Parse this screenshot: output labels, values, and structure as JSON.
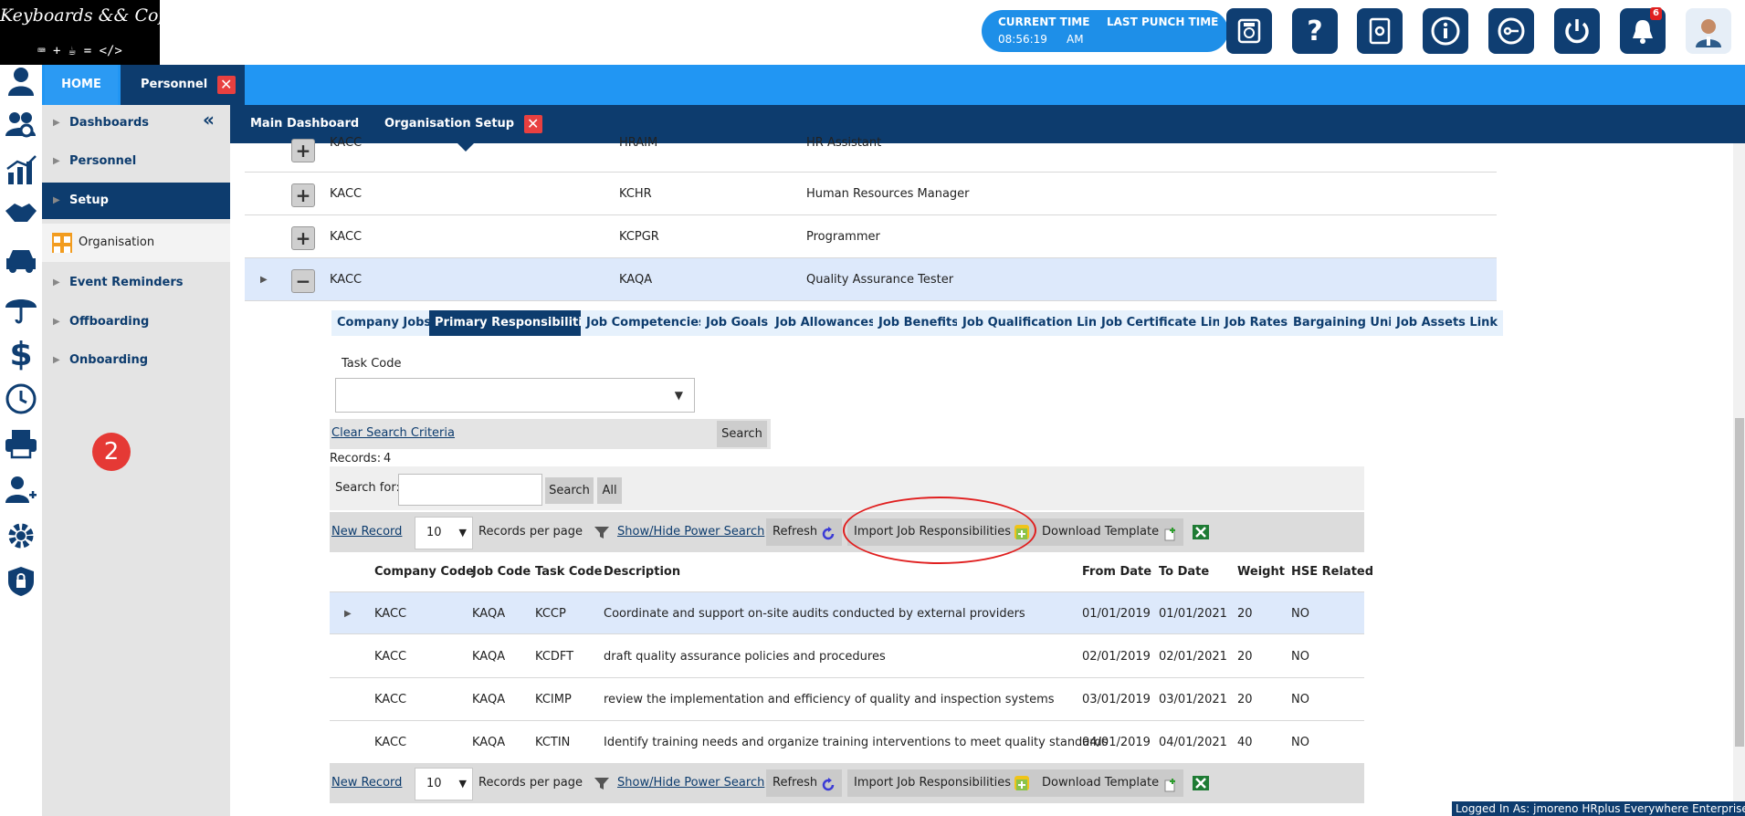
{
  "logo": {
    "title": "Keyboards && Coffee",
    "subtitle": "⌨ + ☕ = </>"
  },
  "topbar": {
    "current_time_label": "CURRENT TIME",
    "last_punch_label": "LAST PUNCH TIME",
    "current_time_value": "08:56:19",
    "am": "AM",
    "notification_count": "6",
    "help_glyph": "?",
    "info_glyph": "i"
  },
  "tabs": {
    "home": "HOME",
    "personnel": "Personnel"
  },
  "subnav": {
    "main_dashboard": "Main Dashboard",
    "organisation_setup": "Organisation Setup"
  },
  "sidebar": {
    "items": [
      {
        "label": "Dashboards"
      },
      {
        "label": "Personnel"
      },
      {
        "label": "Setup"
      },
      {
        "label": "Organisation"
      },
      {
        "label": "Event Reminders"
      },
      {
        "label": "Offboarding"
      },
      {
        "label": "Onboarding"
      }
    ],
    "step_number": "2"
  },
  "jobs": [
    {
      "company": "KACC",
      "code": "HRAIM",
      "title": "HR Assistant"
    },
    {
      "company": "KACC",
      "code": "KCHR",
      "title": "Human Resources Manager"
    },
    {
      "company": "KACC",
      "code": "KCPGR",
      "title": "Programmer"
    },
    {
      "company": "KACC",
      "code": "KAQA",
      "title": "Quality Assurance Tester"
    }
  ],
  "subtabs": [
    "Company Jobs",
    "Primary Responsibilities",
    "Job Competencies",
    "Job Goals",
    "Job Allowances",
    "Job Benefits",
    "Job Qualification Link",
    "Job Certificate Link",
    "Job Rates",
    "Bargaining Unit",
    "Job Assets Link"
  ],
  "filter": {
    "task_code_label": "Task Code",
    "clear_search": "Clear Search Criteria",
    "search_button": "Search",
    "records_label": "Records:",
    "records_count": "4",
    "search_for_label": "Search for:",
    "search_btn2": "Search",
    "all_btn": "All"
  },
  "toolbar": {
    "new_record": "New Record",
    "page_size": "10",
    "records_per_page": "Records per page",
    "power_search": "Show/Hide Power Search",
    "refresh": "Refresh",
    "import": "Import Job Responsibilities",
    "download": "Download Template"
  },
  "grid": {
    "headers": [
      "Company Code",
      "Job Code",
      "Task Code",
      "Description",
      "From Date",
      "To Date",
      "Weight",
      "HSE Related"
    ],
    "rows": [
      {
        "company": "KACC",
        "job": "KAQA",
        "task": "KCCP",
        "desc": "Coordinate and support on-site audits conducted by external providers",
        "from": "01/01/2019",
        "to": "01/01/2021",
        "weight": "20",
        "hse": "NO"
      },
      {
        "company": "KACC",
        "job": "KAQA",
        "task": "KCDFT",
        "desc": "draft quality assurance policies and procedures",
        "from": "02/01/2019",
        "to": "02/01/2021",
        "weight": "20",
        "hse": "NO"
      },
      {
        "company": "KACC",
        "job": "KAQA",
        "task": "KCIMP",
        "desc": "review the implementation and efficiency of quality and inspection systems",
        "from": "03/01/2019",
        "to": "03/01/2021",
        "weight": "20",
        "hse": "NO"
      },
      {
        "company": "KACC",
        "job": "KAQA",
        "task": "KCTIN",
        "desc": "Identify training needs and organize training interventions to meet quality standards",
        "from": "04/01/2019",
        "to": "04/01/2021",
        "weight": "40",
        "hse": "NO"
      }
    ]
  },
  "footer": {
    "logged_in": "Logged In As: jmoreno HRplus Everywhere Enterprise"
  },
  "colors": {
    "navy": "#0d3c6e",
    "blue": "#2196f3",
    "highlight": "#dde9fb",
    "annotation_red": "#e01f1f"
  }
}
